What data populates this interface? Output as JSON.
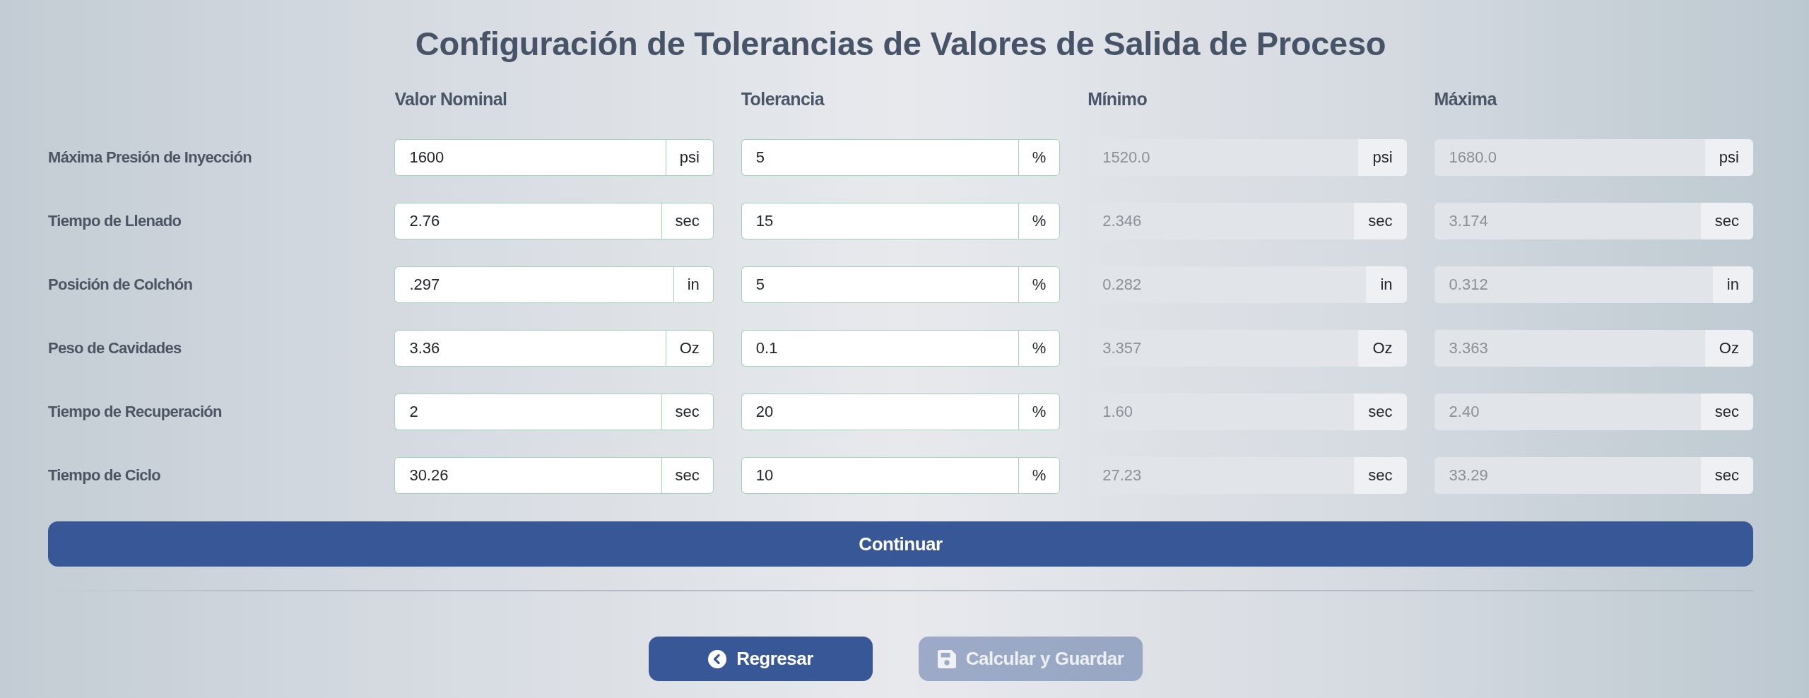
{
  "title": "Configuración de Tolerancias de Valores de Salida de Proceso",
  "columns": [
    "Valor Nominal",
    "Tolerancia",
    "Mínimo",
    "Máxima"
  ],
  "rows": [
    {
      "label": "Máxima Presión de Inyección",
      "fields": [
        {
          "value": "1600",
          "unit": "psi",
          "readonly": false
        },
        {
          "value": "5",
          "unit": "%",
          "readonly": false
        },
        {
          "value": "1520.0",
          "unit": "psi",
          "readonly": true
        },
        {
          "value": "1680.0",
          "unit": "psi",
          "readonly": true
        }
      ]
    },
    {
      "label": "Tiempo de Llenado",
      "fields": [
        {
          "value": "2.76",
          "unit": "sec",
          "readonly": false
        },
        {
          "value": "15",
          "unit": "%",
          "readonly": false
        },
        {
          "value": "2.346",
          "unit": "sec",
          "readonly": true
        },
        {
          "value": "3.174",
          "unit": "sec",
          "readonly": true
        }
      ]
    },
    {
      "label": "Posición de Colchón",
      "fields": [
        {
          "value": ".297",
          "unit": "in",
          "readonly": false
        },
        {
          "value": "5",
          "unit": "%",
          "readonly": false
        },
        {
          "value": "0.282",
          "unit": "in",
          "readonly": true
        },
        {
          "value": "0.312",
          "unit": "in",
          "readonly": true
        }
      ]
    },
    {
      "label": "Peso de Cavidades",
      "fields": [
        {
          "value": "3.36",
          "unit": "Oz",
          "readonly": false
        },
        {
          "value": "0.1",
          "unit": "%",
          "readonly": false
        },
        {
          "value": "3.357",
          "unit": "Oz",
          "readonly": true
        },
        {
          "value": "3.363",
          "unit": "Oz",
          "readonly": true
        }
      ]
    },
    {
      "label": "Tiempo de Recuperación",
      "fields": [
        {
          "value": "2",
          "unit": "sec",
          "readonly": false
        },
        {
          "value": "20",
          "unit": "%",
          "readonly": false
        },
        {
          "value": "1.60",
          "unit": "sec",
          "readonly": true
        },
        {
          "value": "2.40",
          "unit": "sec",
          "readonly": true
        }
      ]
    },
    {
      "label": "Tiempo de Ciclo",
      "fields": [
        {
          "value": "30.26",
          "unit": "sec",
          "readonly": false
        },
        {
          "value": "10",
          "unit": "%",
          "readonly": false
        },
        {
          "value": "27.23",
          "unit": "sec",
          "readonly": true
        },
        {
          "value": "33.29",
          "unit": "sec",
          "readonly": true
        }
      ]
    }
  ],
  "continue_button": {
    "label": "Continuar"
  },
  "actions": [
    {
      "kind": "back",
      "label": "Regresar",
      "disabled": false
    },
    {
      "kind": "save",
      "label": "Calcular y Guardar",
      "disabled": true
    }
  ]
}
